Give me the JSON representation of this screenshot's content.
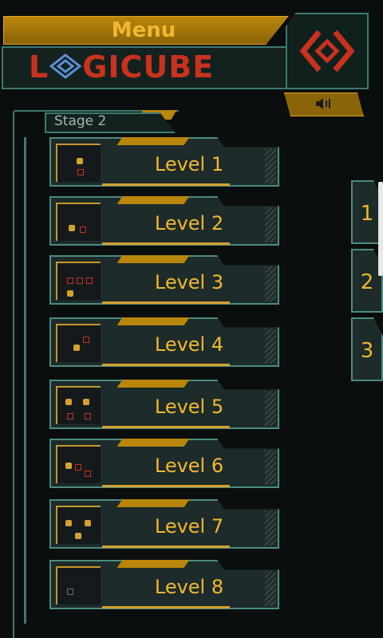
{
  "header": {
    "menu_label": "Menu",
    "logo_text_left": "L",
    "logo_text_right": "GICUBE",
    "logo_color": "#c8321e",
    "accent_color": "#f0b830",
    "frame_color": "#3d7a70",
    "sound_icon": "speaker-icon"
  },
  "stage": {
    "label": "Stage 2"
  },
  "levels": [
    {
      "label": "Level 1"
    },
    {
      "label": "Level 2"
    },
    {
      "label": "Level 3"
    },
    {
      "label": "Level 4"
    },
    {
      "label": "Level 5"
    },
    {
      "label": "Level 6"
    },
    {
      "label": "Level 7"
    },
    {
      "label": "Level 8"
    }
  ],
  "pages": [
    {
      "label": "1"
    },
    {
      "label": "2"
    },
    {
      "label": "3"
    }
  ]
}
